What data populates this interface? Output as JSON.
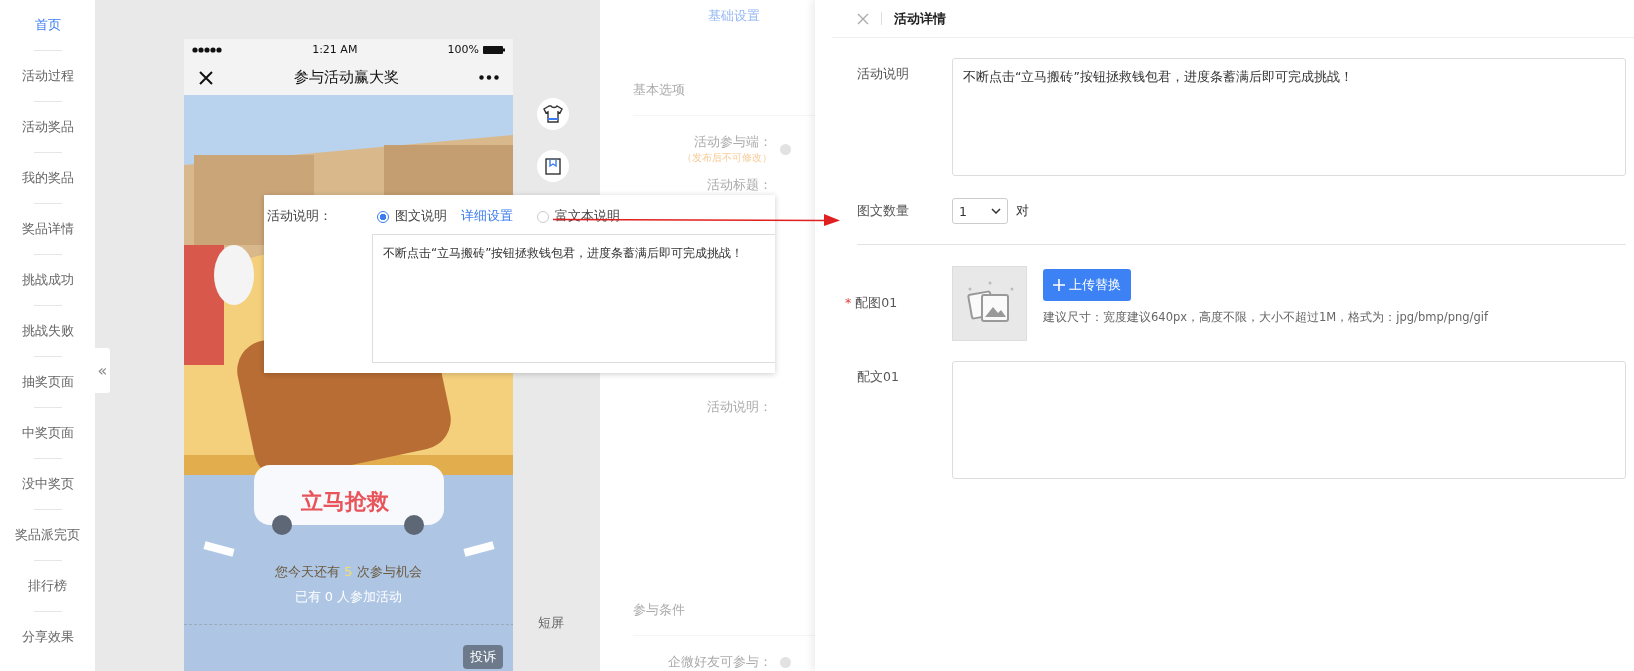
{
  "sidebar": {
    "items": [
      {
        "label": "首页",
        "selected": true
      },
      {
        "label": "活动过程",
        "selected": false
      },
      {
        "label": "活动奖品",
        "selected": false
      },
      {
        "label": "我的奖品",
        "selected": false
      },
      {
        "label": "奖品详情",
        "selected": false
      },
      {
        "label": "挑战成功",
        "selected": false
      },
      {
        "label": "挑战失败",
        "selected": false
      },
      {
        "label": "抽奖页面",
        "selected": false
      },
      {
        "label": "中奖页面",
        "selected": false
      },
      {
        "label": "没中奖页",
        "selected": false
      },
      {
        "label": "奖品派完页",
        "selected": false
      },
      {
        "label": "排行榜",
        "selected": false
      },
      {
        "label": "分享效果",
        "selected": false
      }
    ]
  },
  "collapse_toggle": "«",
  "phone": {
    "time": "1:21 AM",
    "battery": "100%",
    "title": "参与活动赢大奖",
    "rescue_button": "立马抢救",
    "chances": {
      "prefix": "您今天还有",
      "count": "5",
      "suffix": "次参与机会"
    },
    "participants": "已有 0 人参加活动",
    "report_button": "投诉"
  },
  "short_screen_label": "短屏",
  "settings_panel": {
    "tab": "基础设置",
    "section_1": "基本选项",
    "fields": [
      {
        "label": "活动参与端：",
        "note": "（发布后不可修改）",
        "help": true
      },
      {
        "label": "活动标题：",
        "help": false
      },
      {
        "label": "活动说明：",
        "help": false
      }
    ],
    "section_2": "参与条件",
    "condition_label": "企微好友可参与："
  },
  "popup": {
    "label": "活动说明：",
    "options": [
      {
        "label": "图文说明",
        "selected": true
      },
      {
        "label": "富文本说明",
        "selected": false
      }
    ],
    "link": "详细设置",
    "text": "不断点击“立马搬砖”按钮拯救钱包君，进度条蓄满后即可完成挑战！"
  },
  "drawer": {
    "title": "活动详情",
    "description_label": "活动说明",
    "description": "不断点击“立马搬砖”按钮拯救钱包君，进度条蓄满后即可完成挑战！",
    "count_label": "图文数量",
    "count_value": "1",
    "count_unit": "对",
    "image_label": "配图01",
    "required_mark": "*",
    "upload_button": "上传替换",
    "hint": "建议尺寸：宽度建议640px，高度不限，大小不超过1M，格式为：jpg/bmp/png/gif",
    "caption_label": "配文01"
  }
}
